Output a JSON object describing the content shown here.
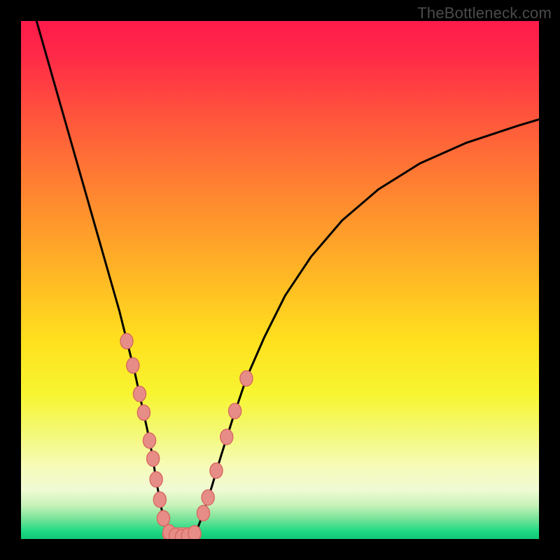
{
  "watermark": "TheBottleneck.com",
  "colors": {
    "frame": "#000000",
    "curve": "#000000",
    "marker_fill": "#e78d87",
    "marker_stroke": "#d96a63",
    "gradient_stops": [
      {
        "offset": 0.0,
        "color": "#ff1a4b"
      },
      {
        "offset": 0.07,
        "color": "#ff2b47"
      },
      {
        "offset": 0.2,
        "color": "#ff5a3b"
      },
      {
        "offset": 0.35,
        "color": "#ff8b2f"
      },
      {
        "offset": 0.5,
        "color": "#ffba24"
      },
      {
        "offset": 0.62,
        "color": "#ffe11e"
      },
      {
        "offset": 0.72,
        "color": "#f7f531"
      },
      {
        "offset": 0.8,
        "color": "#f3f97a"
      },
      {
        "offset": 0.86,
        "color": "#f6fbb9"
      },
      {
        "offset": 0.905,
        "color": "#f0fad4"
      },
      {
        "offset": 0.935,
        "color": "#c7f2b8"
      },
      {
        "offset": 0.96,
        "color": "#7be49a"
      },
      {
        "offset": 0.985,
        "color": "#1fd983"
      },
      {
        "offset": 1.0,
        "color": "#12c777"
      }
    ]
  },
  "chart_data": {
    "type": "line",
    "title": "",
    "xlabel": "",
    "ylabel": "",
    "xlim": [
      0,
      100
    ],
    "ylim": [
      0,
      100
    ],
    "series": [
      {
        "name": "left-branch",
        "x": [
          3,
          5,
          7,
          9,
          11,
          13,
          15,
          17,
          19,
          20.5,
          22,
          23.3,
          24.4,
          25.3,
          26.0,
          26.7,
          27.4,
          28.6
        ],
        "y": [
          100,
          93,
          86,
          79,
          72,
          65,
          58,
          51,
          44,
          38,
          32,
          26,
          21,
          16.5,
          12,
          8,
          4.5,
          1.3
        ]
      },
      {
        "name": "valley-floor",
        "x": [
          28.6,
          29.2,
          30.0,
          31.0,
          32.0,
          33.0,
          33.8
        ],
        "y": [
          1.3,
          0.7,
          0.4,
          0.35,
          0.4,
          0.7,
          1.3
        ]
      },
      {
        "name": "right-branch",
        "x": [
          33.8,
          35.2,
          36.8,
          38.6,
          40.8,
          43.5,
          47,
          51,
          56,
          62,
          69,
          77,
          86,
          96,
          100
        ],
        "y": [
          1.3,
          5,
          10,
          16,
          23,
          31,
          39,
          47,
          54.5,
          61.5,
          67.5,
          72.5,
          76.5,
          79.8,
          81
        ]
      }
    ],
    "markers": [
      {
        "x": 20.4,
        "y": 38.2
      },
      {
        "x": 21.6,
        "y": 33.5
      },
      {
        "x": 22.9,
        "y": 28.0
      },
      {
        "x": 23.7,
        "y": 24.4
      },
      {
        "x": 24.8,
        "y": 19.0
      },
      {
        "x": 25.5,
        "y": 15.5
      },
      {
        "x": 26.1,
        "y": 11.5
      },
      {
        "x": 26.8,
        "y": 7.6
      },
      {
        "x": 27.5,
        "y": 4.0
      },
      {
        "x": 28.6,
        "y": 1.3
      },
      {
        "x": 29.8,
        "y": 0.6
      },
      {
        "x": 31.0,
        "y": 0.35
      },
      {
        "x": 32.2,
        "y": 0.6
      },
      {
        "x": 33.5,
        "y": 1.1
      },
      {
        "x": 35.2,
        "y": 5.0
      },
      {
        "x": 36.1,
        "y": 8.0
      },
      {
        "x": 37.7,
        "y": 13.2
      },
      {
        "x": 39.7,
        "y": 19.7
      },
      {
        "x": 41.3,
        "y": 24.7
      },
      {
        "x": 43.5,
        "y": 31.0
      }
    ],
    "floor_capsule": {
      "x0": 28.6,
      "x1": 33.5,
      "y": 0.9
    }
  }
}
